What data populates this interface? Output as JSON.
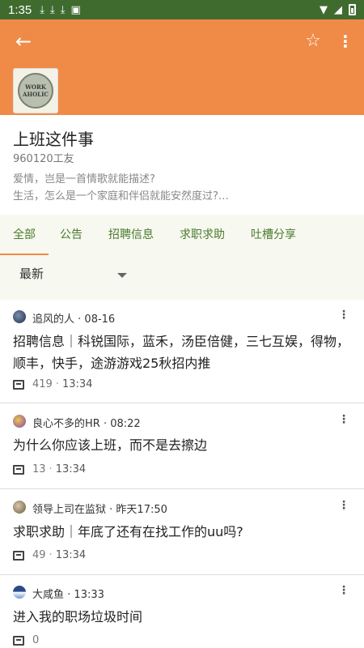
{
  "status_bar": {
    "time": "1:35",
    "left_icons": [
      "download-icon",
      "download-icon",
      "download-icon",
      "app-icon"
    ],
    "right_icons": [
      "wifi-icon",
      "signal-icon",
      "battery-icon"
    ]
  },
  "appbar": {
    "back_icon": "arrow-left-icon",
    "star_icon": "star-outline-icon",
    "more_icon": "more-vertical-icon",
    "color": "#f08a47"
  },
  "group": {
    "logo_text_1": "WORK",
    "logo_text_2": "AHOLIC",
    "name": "上班这件事",
    "members": "960120工友",
    "desc_line1": "爱情，岂是一首情歌就能描述?",
    "desc_line2": "生活，怎么是一个家庭和伴侣就能安然度过?…"
  },
  "tabs": [
    "全部",
    "公告",
    "招聘信息",
    "求职求助",
    "吐槽分享"
  ],
  "sort": {
    "selected": "最新"
  },
  "posts": [
    {
      "author": "追风的人",
      "time": "08-16",
      "title": "招聘信息｜科锐国际，蓝禾，汤臣倍健，三七互娱，得物，顺丰，快手，途游游戏25秋招内推",
      "comments": "419",
      "last_time": "13:34"
    },
    {
      "author": "良心不多的HR",
      "time": "08:22",
      "title": "为什么你应该上班，而不是去擦边",
      "comments": "13",
      "last_time": "13:34"
    },
    {
      "author": "领导上司在监狱",
      "time": "昨天17:50",
      "title": "求职求助｜年底了还有在找工作的uu吗?",
      "comments": "49",
      "last_time": "13:34"
    },
    {
      "author": "大咸鱼",
      "time": "13:33",
      "title": "进入我的职场垃圾时间",
      "comments": "0",
      "last_time": ""
    }
  ]
}
